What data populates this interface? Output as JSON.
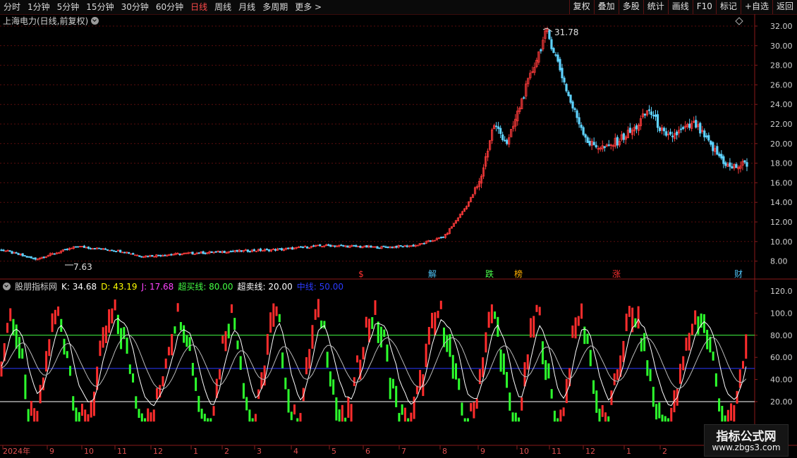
{
  "toolbar": {
    "periods": [
      "分时",
      "1分钟",
      "5分钟",
      "15分钟",
      "30分钟",
      "60分钟",
      "日线",
      "周线",
      "月线",
      "多周期",
      "更多 >"
    ],
    "active_period": "日线",
    "buttons": [
      "复权",
      "叠加",
      "多股",
      "统计",
      "画线",
      "F10",
      "标记",
      "+自选",
      "返回"
    ]
  },
  "main_chart": {
    "title": "上海电力(日线,前复权)",
    "price_axis": [
      "32.00",
      "30.00",
      "28.00",
      "26.00",
      "24.00",
      "22.00",
      "20.00",
      "18.00",
      "16.00",
      "14.00",
      "12.00",
      "10.00",
      "8.00"
    ],
    "high_label": "31.78",
    "low_label": "7.63",
    "event_markers": [
      {
        "text": "$",
        "color": "#ff3030"
      },
      {
        "text": "解",
        "color": "#4fc3f7"
      },
      {
        "text": "跌",
        "color": "#4cff4c"
      },
      {
        "text": "榜",
        "color": "#ffae00"
      },
      {
        "text": "涨",
        "color": "#ff3030"
      },
      {
        "text": "财",
        "color": "#4fc3f7"
      }
    ],
    "colors": {
      "up": "#ff3b3b",
      "down": "#5fd3ff",
      "grid": "#5a0d0d"
    }
  },
  "indicator": {
    "name": "股朋指标网",
    "k": "K: 34.68",
    "d": "D: 43.19",
    "j": "J: 17.68",
    "overbought": "超买线: 80.00",
    "oversold": "超卖线: 20.00",
    "midline": "中线: 50.00",
    "axis": [
      "120.0",
      "100.0",
      "80.00",
      "60.00",
      "40.00",
      "20.00"
    ],
    "colors": {
      "k": "#ffffff",
      "d": "#ffff00",
      "j": "#ff44ff",
      "overbought": "#44ff44",
      "oversold": "#ffffff",
      "midline": "#2b3bff"
    }
  },
  "time_axis": [
    "2024年",
    "9",
    "10",
    "11",
    "12",
    "1",
    "2",
    "3",
    "4",
    "5",
    "6",
    "7",
    "8",
    "9",
    "10",
    "11",
    "12",
    "1",
    "2"
  ],
  "watermark": {
    "title": "指标公式网",
    "url": "www.zbgs3.com"
  }
}
